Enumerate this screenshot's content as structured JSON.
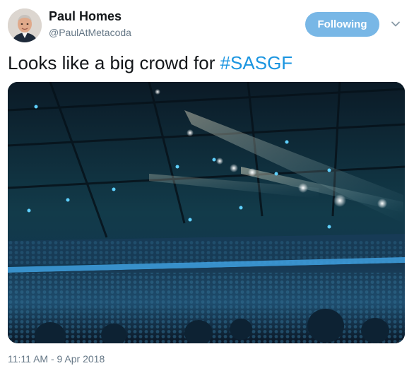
{
  "author": {
    "name": "Paul Homes",
    "handle": "@PaulAtMetacoda"
  },
  "follow_button": {
    "label": "Following"
  },
  "tweet": {
    "text_before": "Looks like a big crowd for ",
    "hashtag": "#SASGF"
  },
  "timestamp": "11:11 AM - 9 Apr 2018",
  "colors": {
    "name": "#14171a",
    "secondary": "#657786",
    "link": "#1b95e0",
    "follow_button_bg": "#78b7e6"
  },
  "icons": {
    "caret": "chevron-down-icon"
  }
}
